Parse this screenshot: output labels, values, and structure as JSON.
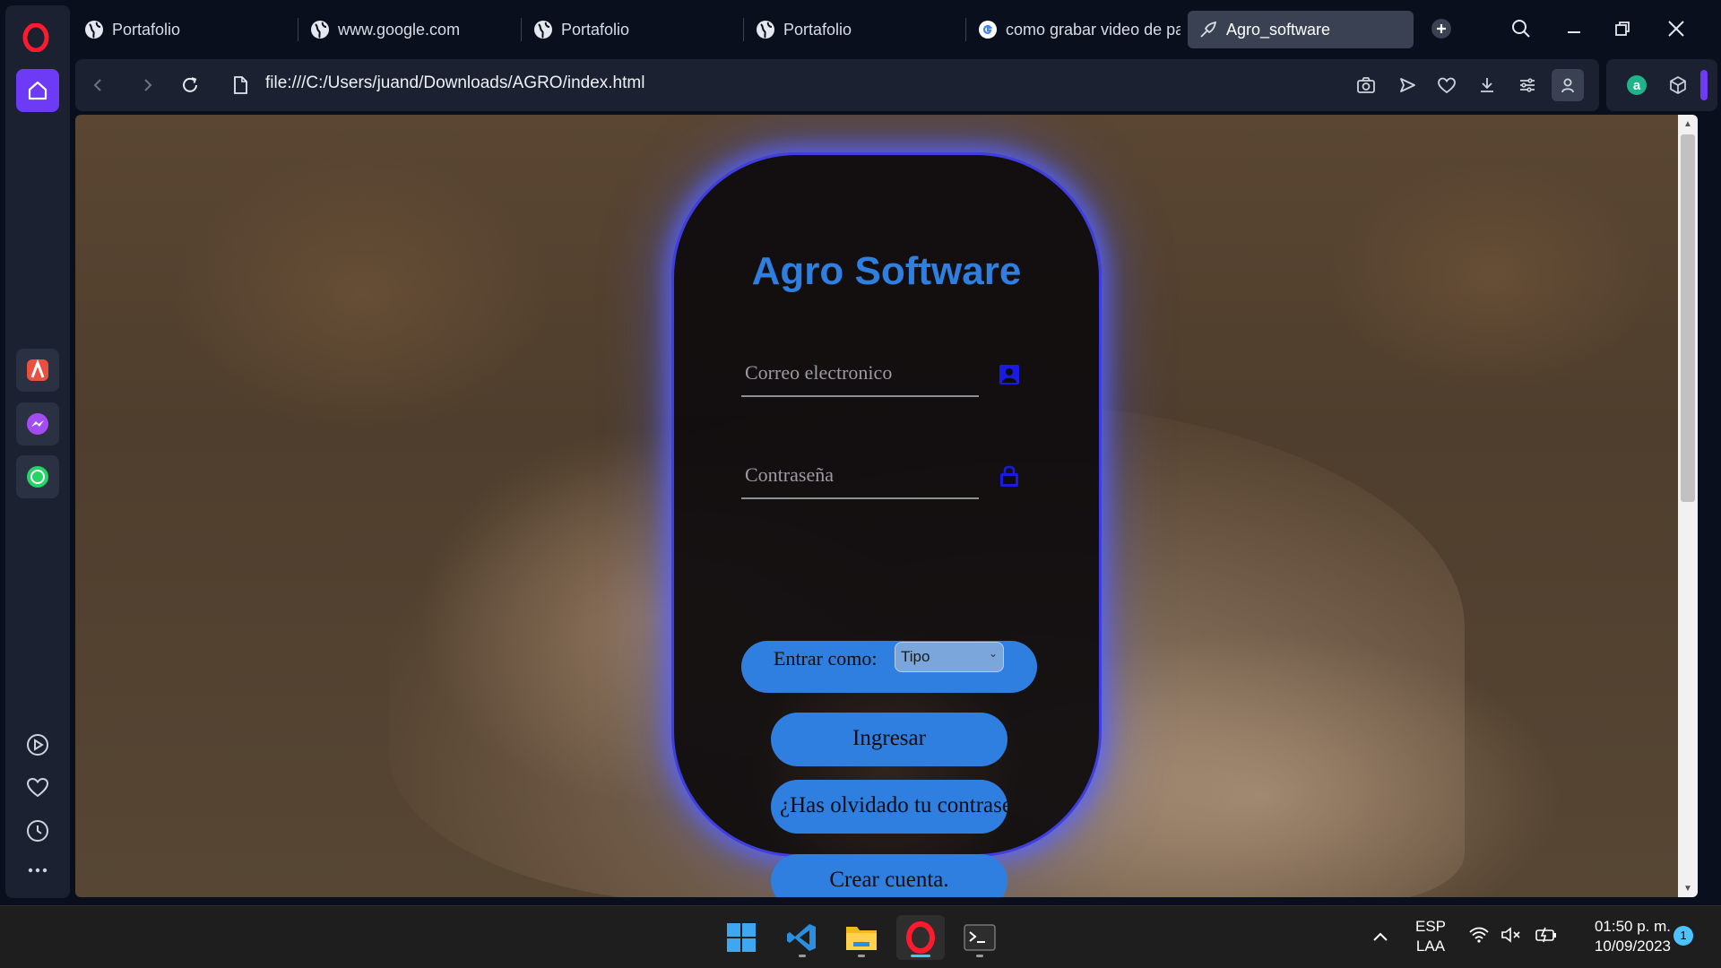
{
  "browser": {
    "tabs": [
      {
        "label": "Portafolio",
        "icon": "globe-icon"
      },
      {
        "label": "www.google.com",
        "icon": "globe-icon"
      },
      {
        "label": "Portafolio",
        "icon": "globe-icon"
      },
      {
        "label": "Portafolio",
        "icon": "globe-icon"
      },
      {
        "label": "como grabar video de pa",
        "icon": "google-icon"
      },
      {
        "label": "Agro_software",
        "icon": "agro-icon",
        "active": true
      }
    ],
    "url": "file:///C:/Users/juand/Downloads/AGRO/index.html"
  },
  "page": {
    "title": "Agro Software",
    "email_placeholder": "Correo electronico",
    "password_placeholder": "Contraseña",
    "role_label": "Entrar como:",
    "role_select_value": "Tipo",
    "login_button": "Ingresar",
    "forgot_button": "¿Has olvidado tu contraseña?",
    "create_account_button": "Crear cuenta."
  },
  "taskbar": {
    "language": "ESP",
    "layout": "LAA",
    "time": "01:50 p. m.",
    "date": "10/09/2023",
    "notifications": "1"
  },
  "colors": {
    "accent": "#2f7fe0",
    "opera_red": "#ff1b2d",
    "home_purple": "#6d3bf5",
    "card_glow": "#3f3ee0"
  }
}
